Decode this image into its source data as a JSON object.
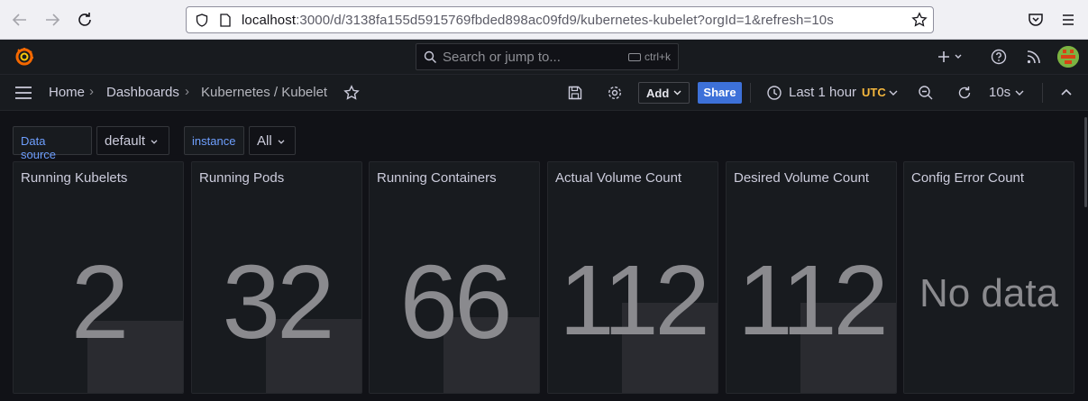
{
  "browser": {
    "url_host": "localhost",
    "url_rest": ":3000/d/3138fa155d5915769fbded898ac09fd9/kubernetes-kubelet?orgId=1&refresh=10s"
  },
  "topbar": {
    "search_placeholder": "Search or jump to...",
    "shortcut": "ctrl+k"
  },
  "breadcrumb": {
    "home": "Home",
    "dashboards": "Dashboards",
    "current": "Kubernetes / Kubelet",
    "sep": "›"
  },
  "toolbar": {
    "add_label": "Add",
    "share_label": "Share",
    "time_range": "Last 1 hour",
    "timezone": "UTC",
    "refresh_interval": "10s"
  },
  "variables": [
    {
      "label": "Data source",
      "value": "default"
    },
    {
      "label": "instance",
      "value": "All"
    }
  ],
  "panels": [
    {
      "title": "Running Kubelets",
      "value": "2"
    },
    {
      "title": "Running Pods",
      "value": "32"
    },
    {
      "title": "Running Containers",
      "value": "66"
    },
    {
      "title": "Actual Volume Count",
      "value": "112"
    },
    {
      "title": "Desired Volume Count",
      "value": "112"
    },
    {
      "title": "Config Error Count",
      "value": "No data"
    }
  ],
  "colors": {
    "accent": "#3d71d9",
    "timezone": "#f5b73d",
    "variable_label": "#6e9fff"
  }
}
